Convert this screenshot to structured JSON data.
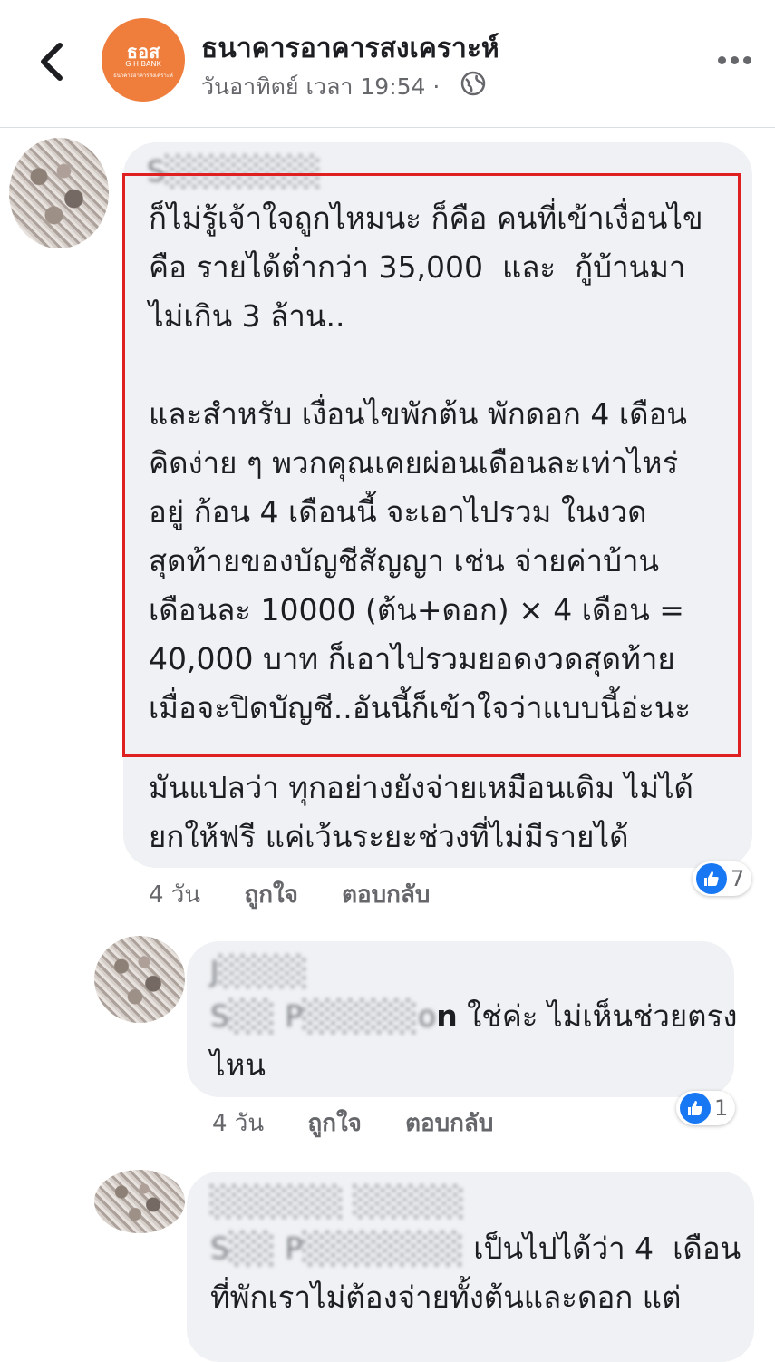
{
  "header": {
    "page_name": "ธนาคารอาคารสงเคราะห์",
    "timestamp": "วันอาทิตย์ เวลา 19:54 ·",
    "logo": {
      "brand": "ธอส",
      "sub": "G H BANK",
      "tagline": "ธนาคารอาคารสงเคราะห์"
    }
  },
  "comments": [
    {
      "author_blurred": "S░░░░░░░",
      "text_highlighted": "ก็ไม่รู้เจ้าใจถูกไหมนะ ก็คือ คนที่เข้าเงื่อนไข\nคือ รายได้ต่ำกว่า 35,000  และ  กู้บ้านมา\nไม่เกิน 3 ล้าน..\n\nและสำหรับ เงื่อนไขพักต้น พักดอก 4 เดือน\nคิดง่าย ๆ พวกคุณเคยผ่อนเดือนละเท่าไหร่\nอยู่ ก้อน 4 เดือนนี้ จะเอาไปรวม ในงวด\nสุดท้ายของบัญชีสัญญา เช่น จ่ายค่าบ้าน\nเดือนละ 10000 (ต้น+ดอก) × 4 เดือน =\n40,000 บาท ก็เอาไปรวมยอดงวดสุดท้าย\nเมื่อจะปิดบัญชี..อันนี้ก็เข้าใจว่าแบบนี้อ่ะนะ",
      "text_rest": "มันแปลว่า ทุกอย่างยังจ่ายเหมือนเดิม ไม่ได้\nยกให้ฟรี แค่เว้นระยะช่วงที่ไม่มีรายได้",
      "time": "4 วัน",
      "like_label": "ถูกใจ",
      "reply_label": "ตอบกลับ",
      "reactions": "7"
    },
    {
      "author_blurred": "J░░░░",
      "mention_blurred": "S░░ P░░░░░o",
      "mention_tail": "n",
      "text": " ใช่ค่ะ ไม่เห็นช่วยตรง\nไหน",
      "time": "4 วัน",
      "like_label": "ถูกใจ",
      "reply_label": "ตอบกลับ",
      "reactions": "1"
    },
    {
      "author_blurred": "░░░░░░ ░░░░░",
      "mention_blurred": "S░░ P░░░░░░░",
      "text": " เป็นไปได้ว่า 4  เดือน\nที่พักเราไม่ต้องจ่ายทั้งต้นและดอก แต่"
    }
  ],
  "colors": {
    "accent": "#1877f2",
    "highlight_border": "#e02020",
    "bubble": "#eff1f4",
    "logo": "#ef7d3c"
  }
}
